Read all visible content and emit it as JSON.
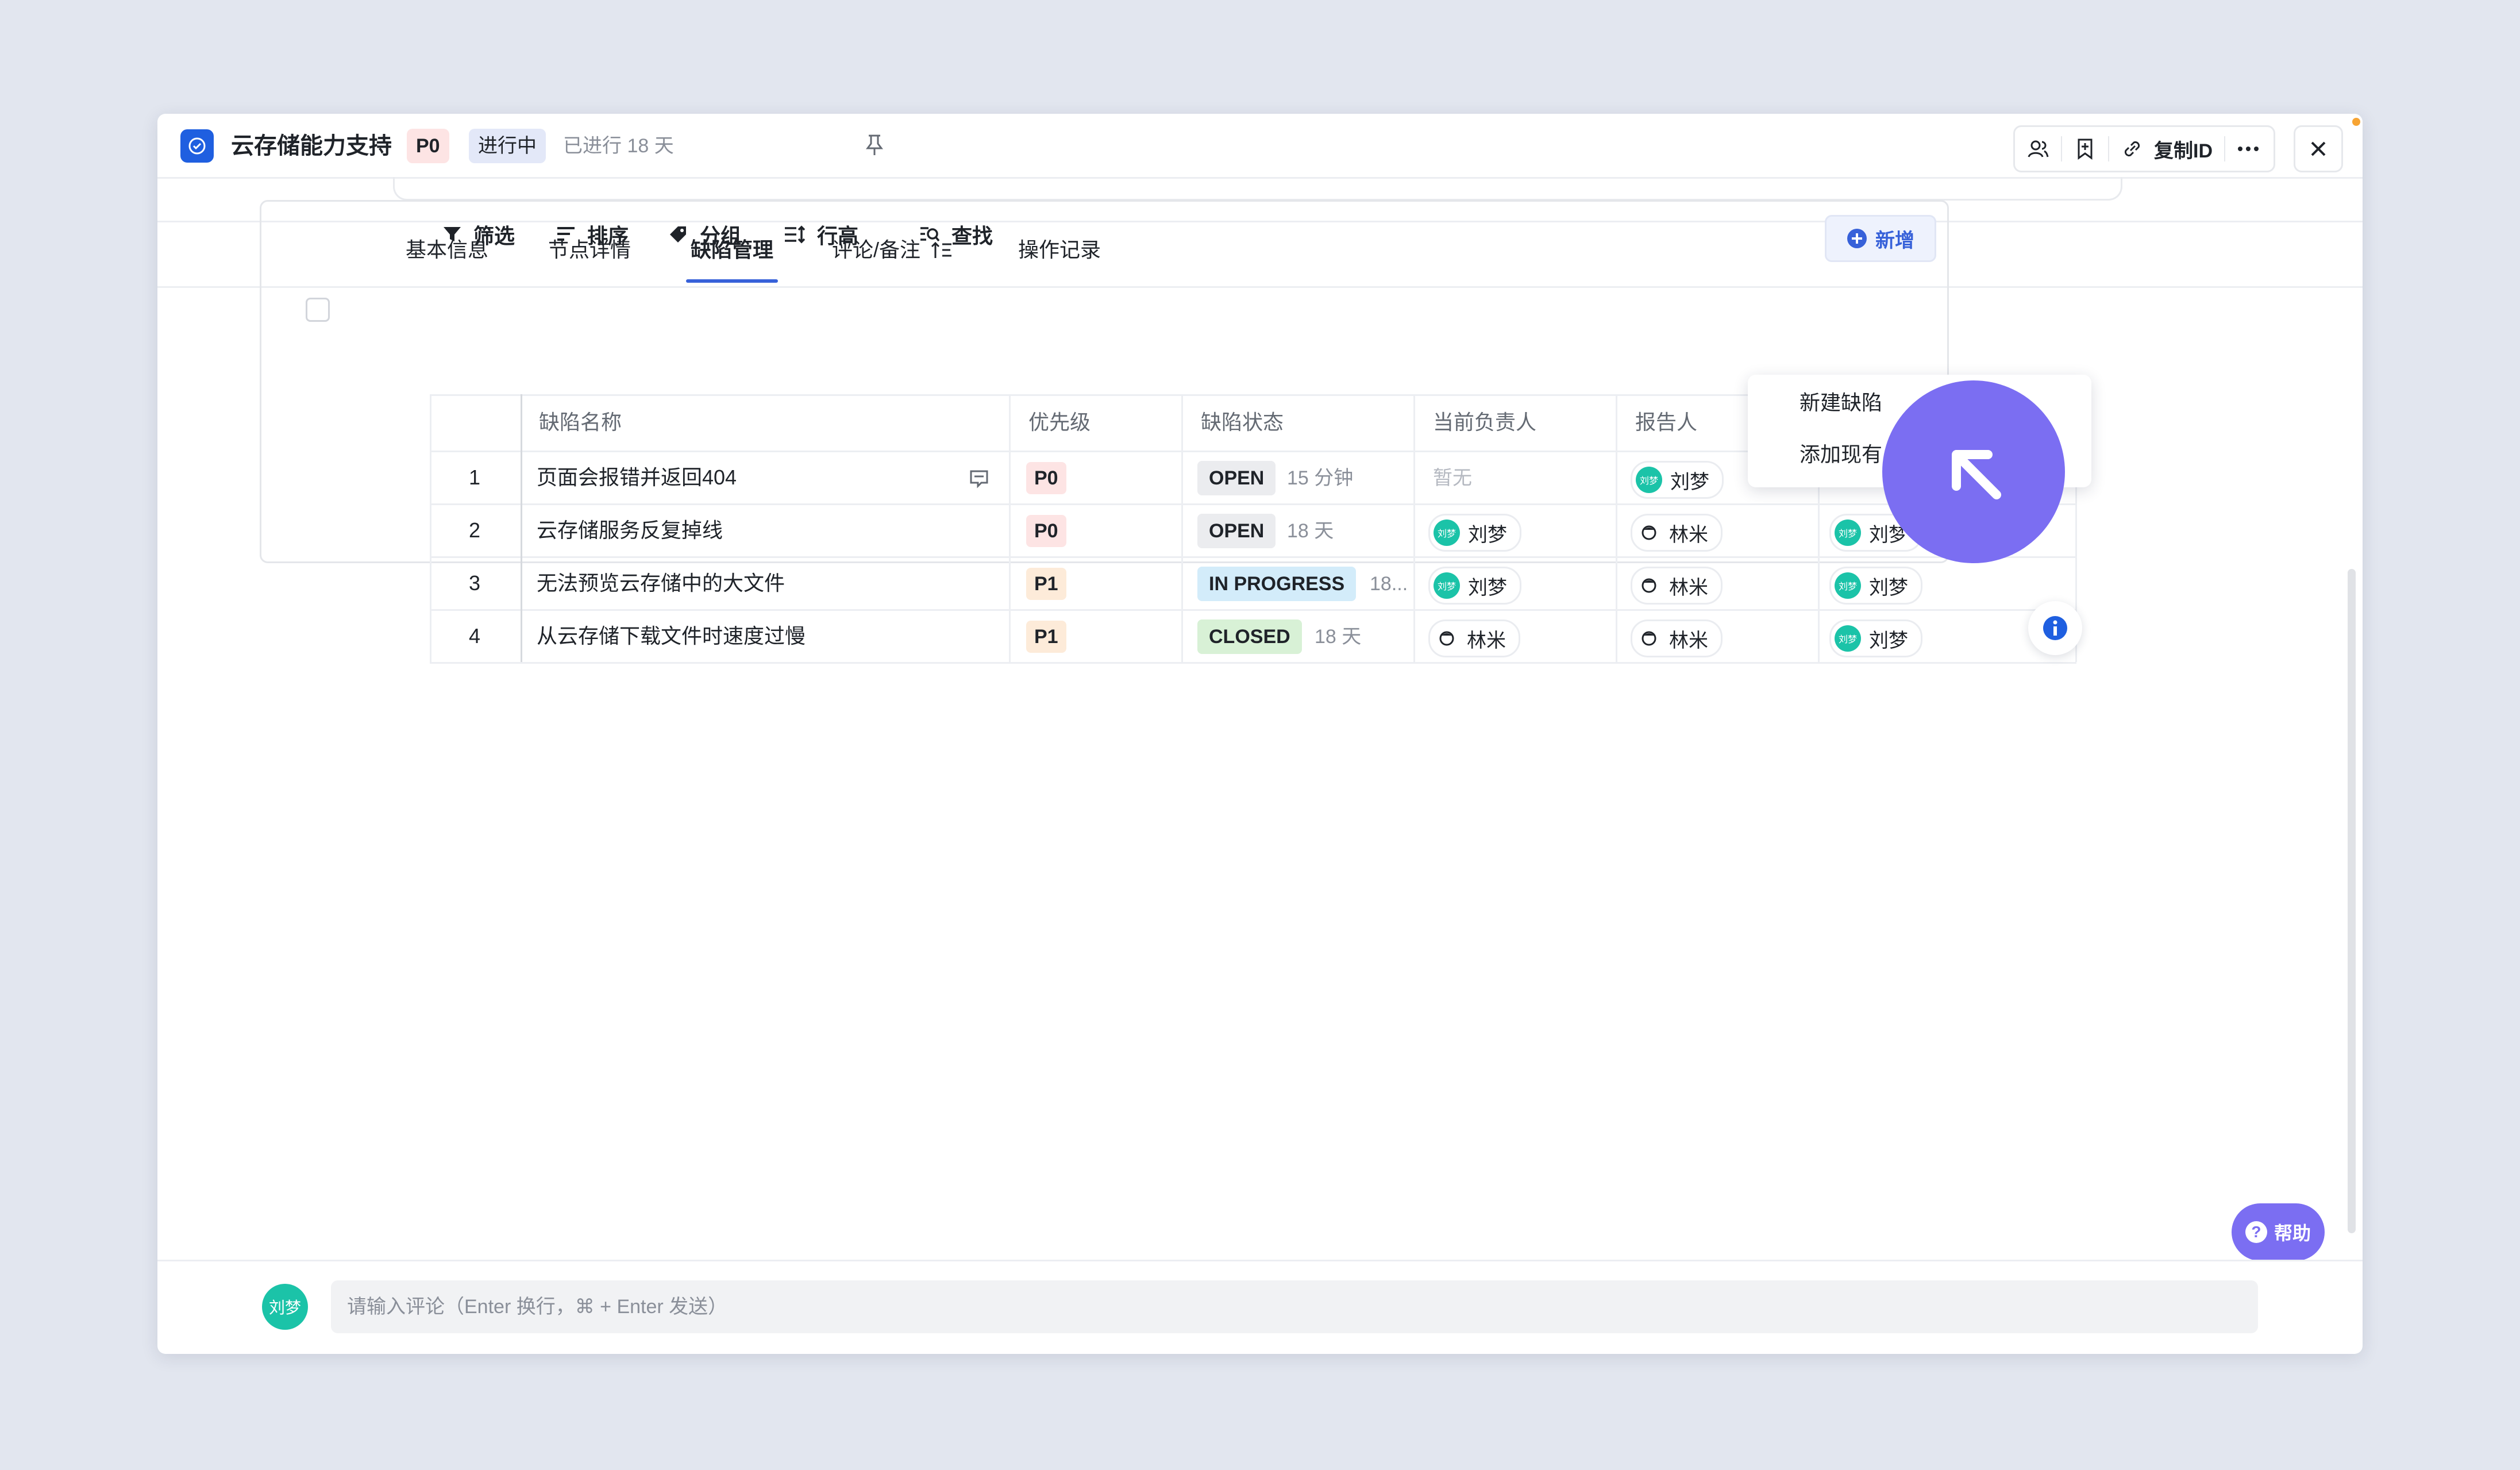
{
  "header": {
    "title": "云存储能力支持",
    "priority": "P0",
    "status": "进行中",
    "elapsed": "已进行 18 天",
    "copy_id_label": "复制ID"
  },
  "tabs": [
    {
      "label": "基本信息"
    },
    {
      "label": "节点详情"
    },
    {
      "label": "缺陷管理",
      "active": true
    },
    {
      "label": "评论/备注"
    },
    {
      "label": "操作记录"
    }
  ],
  "toolbar": {
    "filter": "筛选",
    "sort": "排序",
    "group": "分组",
    "row_height": "行高",
    "search": "查找",
    "new": "新增"
  },
  "table": {
    "columns": [
      "缺陷名称",
      "优先级",
      "缺陷状态",
      "当前负责人",
      "报告人"
    ],
    "rows": [
      {
        "num": "1",
        "name": "页面会报错并返回404",
        "priority": "P0",
        "status": "OPEN",
        "duration": "15 分钟",
        "assignee": "暂无",
        "reporter": "刘梦",
        "extra": ""
      },
      {
        "num": "2",
        "name": "云存储服务反复掉线",
        "priority": "P0",
        "status": "OPEN",
        "duration": "18 天",
        "assignee": "刘梦",
        "reporter": "林米",
        "extra": "刘梦"
      },
      {
        "num": "3",
        "name": "无法预览云存储中的大文件",
        "priority": "P1",
        "status": "IN PROGRESS",
        "duration": "18...",
        "assignee": "刘梦",
        "reporter": "林米",
        "extra": "刘梦"
      },
      {
        "num": "4",
        "name": "从云存储下载文件时速度过慢",
        "priority": "P1",
        "status": "CLOSED",
        "duration": "18 天",
        "assignee": "林米",
        "reporter": "林米",
        "extra": "刘梦"
      }
    ]
  },
  "dropdown": {
    "items": [
      "新建缺陷",
      "添加现有"
    ]
  },
  "help": {
    "label": "帮助"
  },
  "comment": {
    "avatar_text": "刘梦",
    "placeholder": "请输入评论（Enter 换行，⌘ + Enter 发送）"
  },
  "icons": [
    "check-circle-icon",
    "pin-icon",
    "members-icon",
    "bookmark-icon",
    "link-icon",
    "more-icon",
    "close-icon",
    "filter-icon",
    "sort-icon",
    "tag-icon",
    "row-height-icon",
    "search-icon",
    "plus-circle-icon",
    "comment-icon",
    "info-icon",
    "arrow-cursor-icon",
    "question-icon"
  ],
  "colors": {
    "accent": "#3761d9",
    "cursor": "#7b6ef2",
    "avatar": "#1bc3a8"
  }
}
